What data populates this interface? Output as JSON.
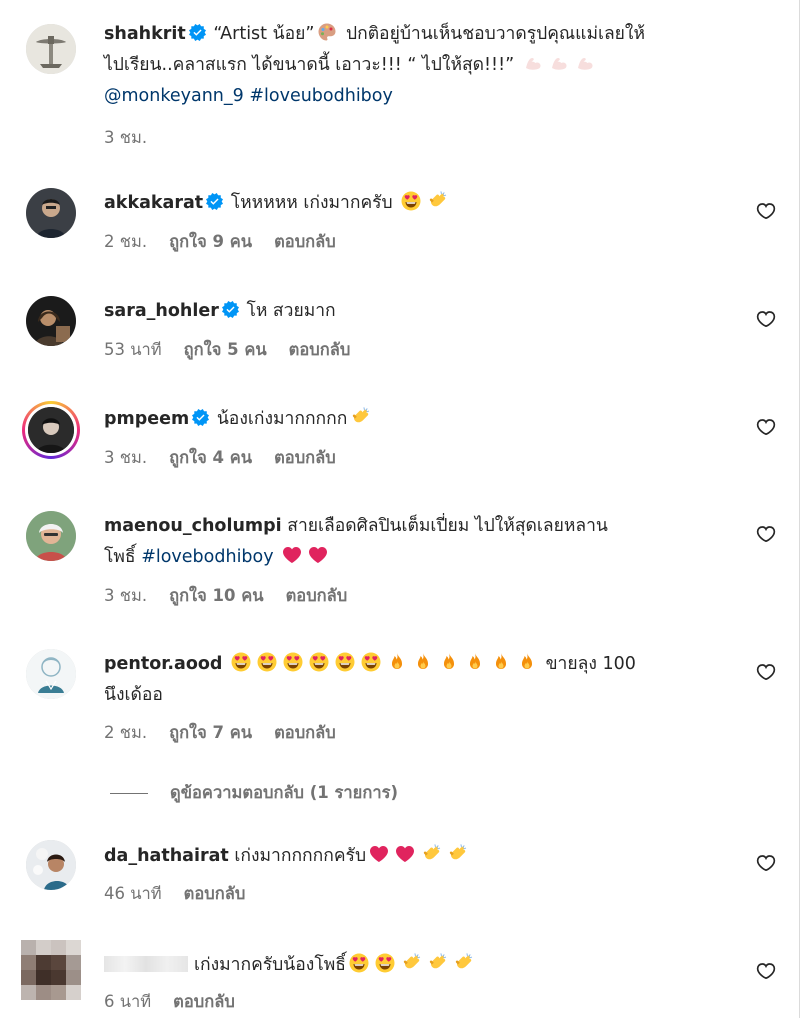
{
  "colors": {
    "text": "#262626",
    "muted": "#737373",
    "link": "#00376b",
    "verified": "#0095f6"
  },
  "post": {
    "username": "shahkrit",
    "caption_line1": "“Artist น้อย”",
    "caption_line1b": "ปกติอยู่บ้านเห็นชอบวาดรูปคุณแม่เลยให้",
    "caption_line2": "ไปเรียน..คลาสแรก ได้ขนาดนี้ เอาวะ!!! “ ไปให้สุด!!!”",
    "mention": "@monkeyann_9",
    "hashtag": "#loveubodhiboy",
    "time": "3 ชม."
  },
  "comments": [
    {
      "username": "akkakarat",
      "text": "โหหหหห เก่งมากครับ",
      "time": "2 ชม.",
      "likes": "ถูกใจ 9 คน",
      "reply": "ตอบกลับ",
      "emoji": [
        "heart-eyes-emoji",
        "clap-emoji"
      ]
    },
    {
      "username": "sara_hohler",
      "text": "โห สวยมาก",
      "time": "53 นาที",
      "likes": "ถูกใจ 5 คน",
      "reply": "ตอบกลับ"
    },
    {
      "username": "pmpeem",
      "text": "น้องเก่งมากกกกก",
      "time": "3 ชม.",
      "likes": "ถูกใจ 4 คน",
      "reply": "ตอบกลับ",
      "emoji": [
        "clap-emoji"
      ]
    },
    {
      "username": "maenou_cholumpi",
      "text": "สายเลือดศิลปินเต็มเปี่ยม ไปให้สุดเลยหลาน",
      "text2": "โพธิ์",
      "hashtag": "#lovebodhiboy",
      "time": "3 ชม.",
      "likes": "ถูกใจ 10 คน",
      "reply": "ตอบกลับ",
      "emoji": [
        "red-heart-emoji",
        "red-heart-emoji"
      ]
    },
    {
      "username": "pentor.aood",
      "text": "ขายลุง 100",
      "text2": "นึงเด้ออ",
      "time": "2 ชม.",
      "likes": "ถูกใจ 7 คน",
      "reply": "ตอบกลับ",
      "emoji": [
        "heart-eyes-emoji x6",
        "fire-emoji x6"
      ]
    },
    {
      "username": "da_hathairat",
      "text": "เก่งมากกกกกครับ",
      "time": "46 นาที",
      "reply": "ตอบกลับ",
      "emoji": [
        "red-heart-emoji",
        "red-heart-emoji",
        "clap-emoji",
        "clap-emoji"
      ]
    },
    {
      "username": "",
      "text": "เก่งมากครับน้องโพธิ์",
      "time": "6 นาที",
      "reply": "ตอบกลับ",
      "emoji": [
        "heart-eyes-emoji",
        "heart-eyes-emoji",
        "clap-emoji",
        "clap-emoji",
        "clap-emoji"
      ]
    }
  ],
  "view_replies": "ดูข้อความตอบกลับ (1 รายการ)",
  "icons": {
    "like": "heart-outline-icon",
    "verified": "verified-badge-icon",
    "palette": "palette-emoji",
    "muscle": "flexed-biceps-emoji"
  }
}
